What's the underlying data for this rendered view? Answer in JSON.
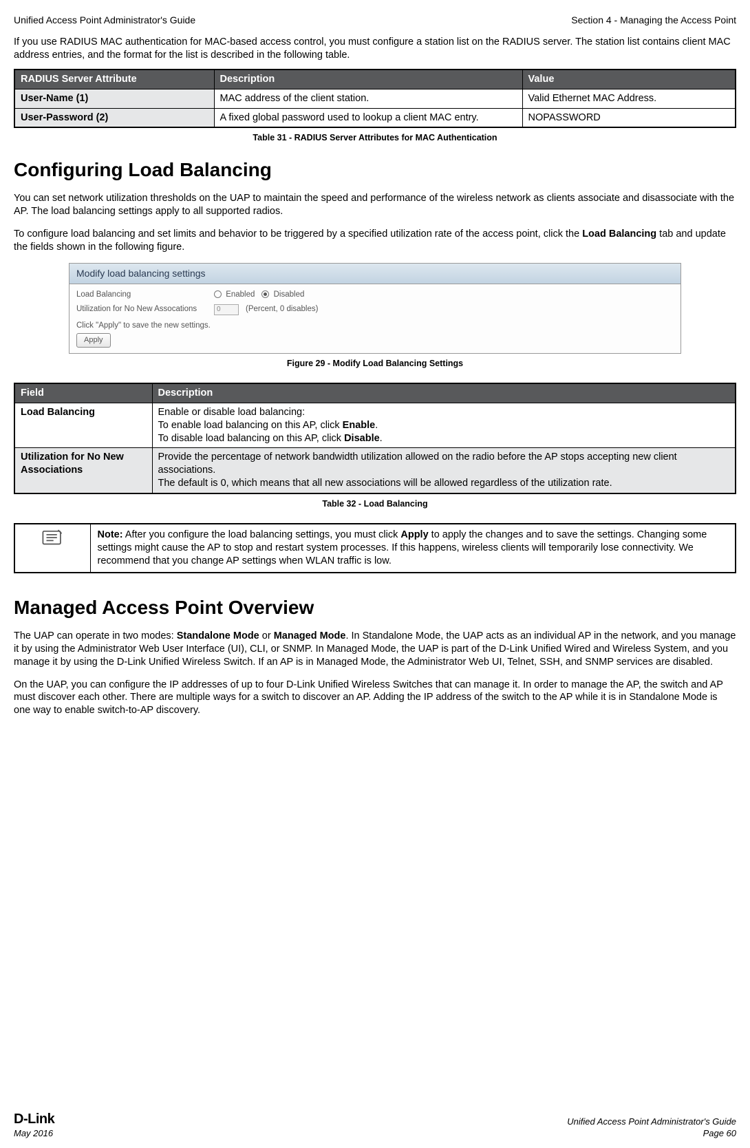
{
  "header": {
    "left": "Unified Access Point Administrator's Guide",
    "right": "Section 4 - Managing the Access Point"
  },
  "intro": "If you use RADIUS MAC authentication for MAC-based access control, you must configure a station list on the RADIUS server. The station list contains client MAC address entries, and the format for the list is described in the following table.",
  "table31": {
    "headers": {
      "c1": "RADIUS Server Attribute",
      "c2": "Description",
      "c3": "Value"
    },
    "rows": [
      {
        "c1": "User-Name (1)",
        "c2": "MAC address of the client station.",
        "c3": "Valid Ethernet MAC Address."
      },
      {
        "c1": "User-Password (2)",
        "c2": "A fixed global password used to lookup a client MAC entry.",
        "c3": "NOPASSWORD"
      }
    ],
    "caption": "Table 31 - RADIUS Server Attributes for MAC Authentication"
  },
  "section1": {
    "title": "Configuring Load Balancing",
    "p1": "You can set network utilization thresholds on the UAP to maintain the speed and performance of the wireless network as clients associate and disassociate with the AP. The load balancing settings apply to all supported radios.",
    "p2a": "To configure load balancing and set limits and behavior to be triggered by a specified utilization rate of the access point, click the ",
    "p2b": "Load Balancing",
    "p2c": " tab and update the fields shown in the following figure."
  },
  "figure29": {
    "title": "Modify load balancing settings",
    "row1": {
      "label": "Load Balancing",
      "opt1": "Enabled",
      "opt2": "Disabled"
    },
    "row2": {
      "label": "Utilization for No New Assocations",
      "value": "0",
      "suffix": "(Percent, 0 disables)"
    },
    "hint": "Click \"Apply\" to save the new settings.",
    "button": "Apply",
    "caption": "Figure 29 - Modify Load Balancing Settings"
  },
  "table32": {
    "headers": {
      "c1": "Field",
      "c2": "Description"
    },
    "rows": [
      {
        "c1": "Load Balancing",
        "l1": "Enable or disable load balancing:",
        "l2a": "To enable load balancing on this AP, click ",
        "l2b": "Enable",
        "l2c": ".",
        "l3a": "To disable load balancing on this AP, click ",
        "l3b": "Disable",
        "l3c": "."
      },
      {
        "c1": "Utilization for No New Associations",
        "l1": "Provide the percentage of network bandwidth utilization allowed on the radio before the AP stops accepting new client associations.",
        "l2": "The default is 0, which means that all new associations will be allowed regardless of the utilization rate."
      }
    ],
    "caption": "Table 32 - Load Balancing"
  },
  "note": {
    "bold": "Note:",
    "t1": " After you configure the load balancing settings, you must click ",
    "bold2": "Apply",
    "t2": " to apply the changes and to save the settings. Changing some settings might cause the AP to stop and restart system processes. If this happens, wireless clients will temporarily lose connectivity. We recommend that you change AP settings when WLAN traffic is low."
  },
  "section2": {
    "title": "Managed Access Point Overview",
    "p1a": "The UAP can operate in two modes: ",
    "p1b": "Standalone Mode",
    "p1c": " or ",
    "p1d": "Managed Mode",
    "p1e": ". In Standalone Mode, the UAP acts as an individual AP in the network, and you manage it by using the Administrator Web User Interface (UI), CLI, or SNMP. In Managed Mode, the UAP is part of the D-Link Unified Wired and Wireless System, and you manage it by using the D-Link Unified Wireless Switch. If an AP is in Managed Mode, the Administrator Web UI, Telnet, SSH, and SNMP services are disabled.",
    "p2": "On the UAP, you can configure the IP addresses of up to four D-Link Unified Wireless Switches that can manage it. In order to manage the AP, the switch and AP must discover each other. There are multiple ways for a switch to discover an AP. Adding the IP address of the switch to the AP while it is in Standalone Mode is one way to enable switch-to-AP discovery."
  },
  "footer": {
    "logo": "D-Link",
    "date": "May 2016",
    "right1": "Unified Access Point Administrator's Guide",
    "right2": "Page 60"
  }
}
